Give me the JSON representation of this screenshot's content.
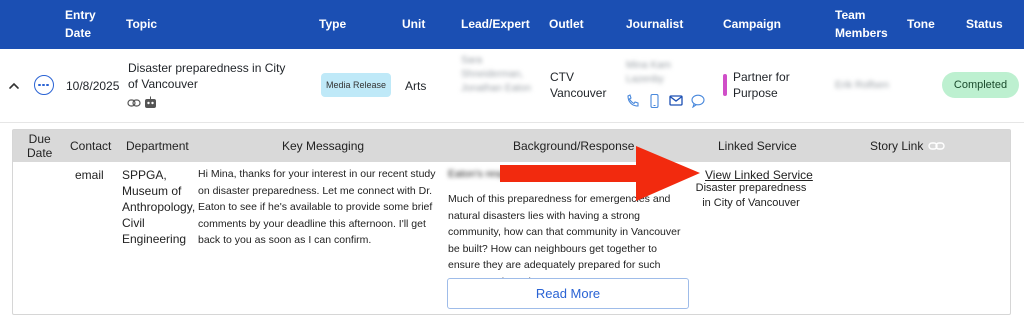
{
  "header": {
    "entry_date": "Entry\nDate",
    "topic": "Topic",
    "type": "Type",
    "unit": "Unit",
    "lead": "Lead/Expert",
    "outlet": "Outlet",
    "journalist": "Journalist",
    "campaign": "Campaign",
    "team": "Team\nMembers",
    "tone": "Tone",
    "status": "Status"
  },
  "row": {
    "date": "10/8/2025",
    "topic": "Disaster preparedness in City of Vancouver",
    "type": "Media Release",
    "unit": "Arts",
    "lead": "Sara Shneiderman, Jonathan Eaton",
    "outlet": "CTV Vancouver",
    "journalist": "Mina Kam Lazenby",
    "campaign": "Partner for Purpose",
    "team": "Erik Rolfsen",
    "status": "Completed",
    "colors": {
      "campaign_bar": "#d04fc8",
      "status_bg": "#bdf0d0",
      "type_bg": "#bfe9f8",
      "header_bg": "#1b4fb3"
    }
  },
  "detail": {
    "headers": {
      "due_date": "Due\nDate",
      "contact": "Contact",
      "department": "Department",
      "key_messaging": "Key Messaging",
      "background": "Background/Response",
      "linked_service": "Linked Service",
      "story_link": "Story Link"
    },
    "contact": "email",
    "department": "SPPGA, Museum of Anthropology, Civil Engineering",
    "key_messaging": "Hi Mina, thanks for your interest in our recent study on disaster preparedness. Let me connect with Dr. Eaton to see if he's available to provide some brief comments by your deadline this afternoon. I'll get back to you as soon as I can confirm.",
    "background_first": "Eaton's response",
    "background": "Much of this preparedness for emergencies and natural disasters lies with having a strong community, how can that community in Vancouver be built? How can neighbours get together to ensure they are adequately prepared for such events? Is there that",
    "linked_service_link": "View Linked Service",
    "linked_service_text": "Disaster preparedness in City of Vancouver",
    "read_more": "Read More"
  }
}
